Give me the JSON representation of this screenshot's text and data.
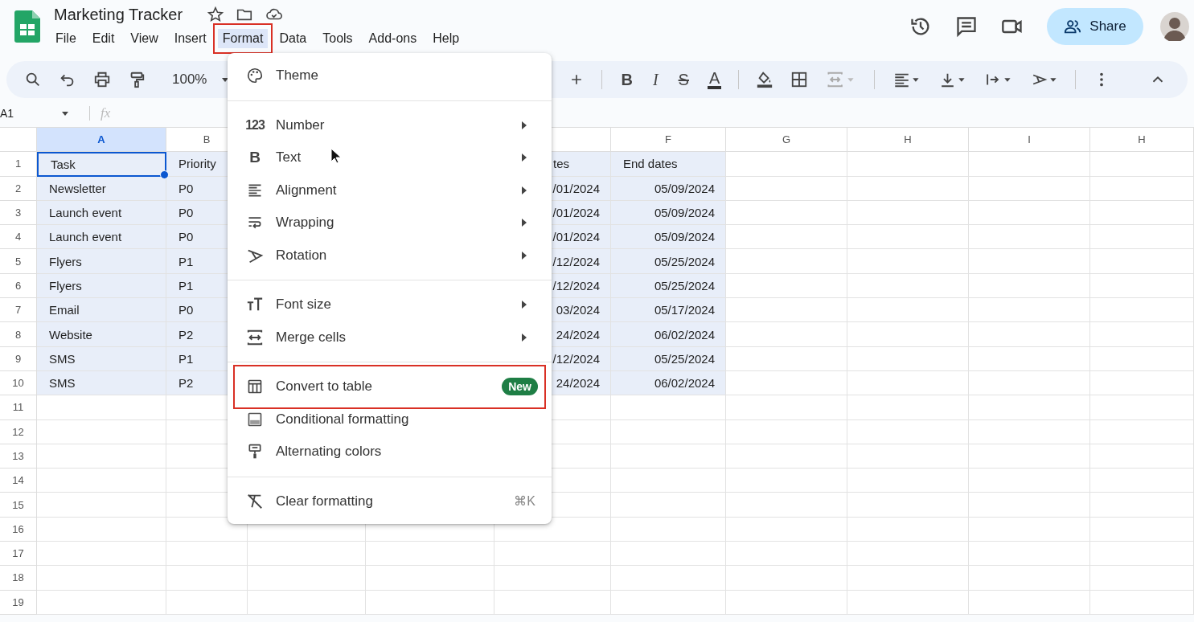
{
  "doc": {
    "title": "Marketing Tracker"
  },
  "menu_bar": [
    {
      "label": "File",
      "selected": false,
      "highlighted": false
    },
    {
      "label": "Edit",
      "selected": false,
      "highlighted": false
    },
    {
      "label": "View",
      "selected": false,
      "highlighted": false
    },
    {
      "label": "Insert",
      "selected": false,
      "highlighted": false
    },
    {
      "label": "Format",
      "selected": true,
      "highlighted": true
    },
    {
      "label": "Data",
      "selected": false,
      "highlighted": false
    },
    {
      "label": "Tools",
      "selected": false,
      "highlighted": false
    },
    {
      "label": "Add-ons",
      "selected": false,
      "highlighted": false
    },
    {
      "label": "Help",
      "selected": false,
      "highlighted": false
    }
  ],
  "share_button": {
    "label": "Share"
  },
  "toolbar": {
    "zoom": "100%",
    "bold": "B",
    "italic": "I",
    "strikethrough": "S",
    "text_color": "A"
  },
  "name_box": "A1",
  "formula_bar": {
    "label": "fx"
  },
  "sheet": {
    "columns": [
      {
        "label": "A",
        "selected": true,
        "in_range": true
      },
      {
        "label": "B",
        "selected": false,
        "in_range": true
      },
      {
        "selected": false,
        "in_range": true
      },
      {
        "label": "F",
        "selected": false,
        "in_range": true
      },
      {
        "label": "G",
        "selected": false,
        "in_range": false
      },
      {
        "label": "H",
        "selected": false,
        "in_range": false
      },
      {
        "label": "I",
        "selected": false,
        "in_range": false
      },
      {
        "label": "H",
        "selected": false,
        "in_range": false
      }
    ],
    "rows": [
      {
        "number": "1",
        "selected": true,
        "a": "Task",
        "b": "Priority",
        "e": "tes",
        "f": "End dates"
      },
      {
        "number": "2",
        "selected": true,
        "a": "Newsletter",
        "b": "P0",
        "e": "/01/2024",
        "f": "05/09/2024"
      },
      {
        "number": "3",
        "selected": true,
        "a": "Launch event",
        "b": "P0",
        "e": "/01/2024",
        "f": "05/09/2024"
      },
      {
        "number": "4",
        "selected": true,
        "a": "Launch event",
        "b": "P0",
        "e": "/01/2024",
        "f": "05/09/2024"
      },
      {
        "number": "5",
        "selected": true,
        "a": "Flyers",
        "b": "P1",
        "e": "/12/2024",
        "f": "05/25/2024"
      },
      {
        "number": "6",
        "selected": true,
        "a": "Flyers",
        "b": "P1",
        "e": "/12/2024",
        "f": "05/25/2024"
      },
      {
        "number": "7",
        "selected": true,
        "a": "Email",
        "b": "P0",
        "e": "03/2024",
        "f": "05/17/2024"
      },
      {
        "number": "8",
        "selected": true,
        "a": "Website",
        "b": "P2",
        "e": "24/2024",
        "f": "06/02/2024"
      },
      {
        "number": "9",
        "selected": true,
        "a": "SMS",
        "b": "P1",
        "e": "/12/2024",
        "f": "05/25/2024"
      },
      {
        "number": "10",
        "selected": true,
        "a": "SMS",
        "b": "P2",
        "e": "24/2024",
        "f": "06/02/2024"
      },
      {
        "number": "11",
        "selected": false
      },
      {
        "number": "12",
        "selected": false
      },
      {
        "number": "13",
        "selected": false
      },
      {
        "number": "14",
        "selected": false
      },
      {
        "number": "15",
        "selected": false
      },
      {
        "number": "16",
        "selected": false
      },
      {
        "number": "17",
        "selected": false
      },
      {
        "number": "18",
        "selected": false
      },
      {
        "number": "19",
        "selected": false
      }
    ]
  },
  "format_menu": {
    "groups": [
      [
        {
          "label": "Theme",
          "submenu": false,
          "highlighted": false
        }
      ],
      [
        {
          "label": "Number",
          "glyph": "123",
          "submenu": true,
          "highlighted": false
        },
        {
          "label": "Text",
          "glyph": "B",
          "submenu": true,
          "highlighted": false
        },
        {
          "label": "Alignment",
          "submenu": true,
          "highlighted": false
        },
        {
          "label": "Wrapping",
          "submenu": true,
          "highlighted": false
        },
        {
          "label": "Rotation",
          "submenu": true,
          "highlighted": false
        }
      ],
      [
        {
          "label": "Font size",
          "submenu": true,
          "highlighted": false
        },
        {
          "label": "Merge cells",
          "submenu": true,
          "highlighted": false
        }
      ],
      [
        {
          "label": "Convert to table",
          "badge": "New",
          "submenu": false,
          "highlighted": true
        },
        {
          "label": "Conditional formatting",
          "submenu": false,
          "highlighted": false
        },
        {
          "label": "Alternating colors",
          "submenu": false,
          "highlighted": false
        }
      ],
      [
        {
          "label": "Clear formatting",
          "shortcut": "⌘K",
          "submenu": false,
          "highlighted": false
        }
      ]
    ]
  }
}
